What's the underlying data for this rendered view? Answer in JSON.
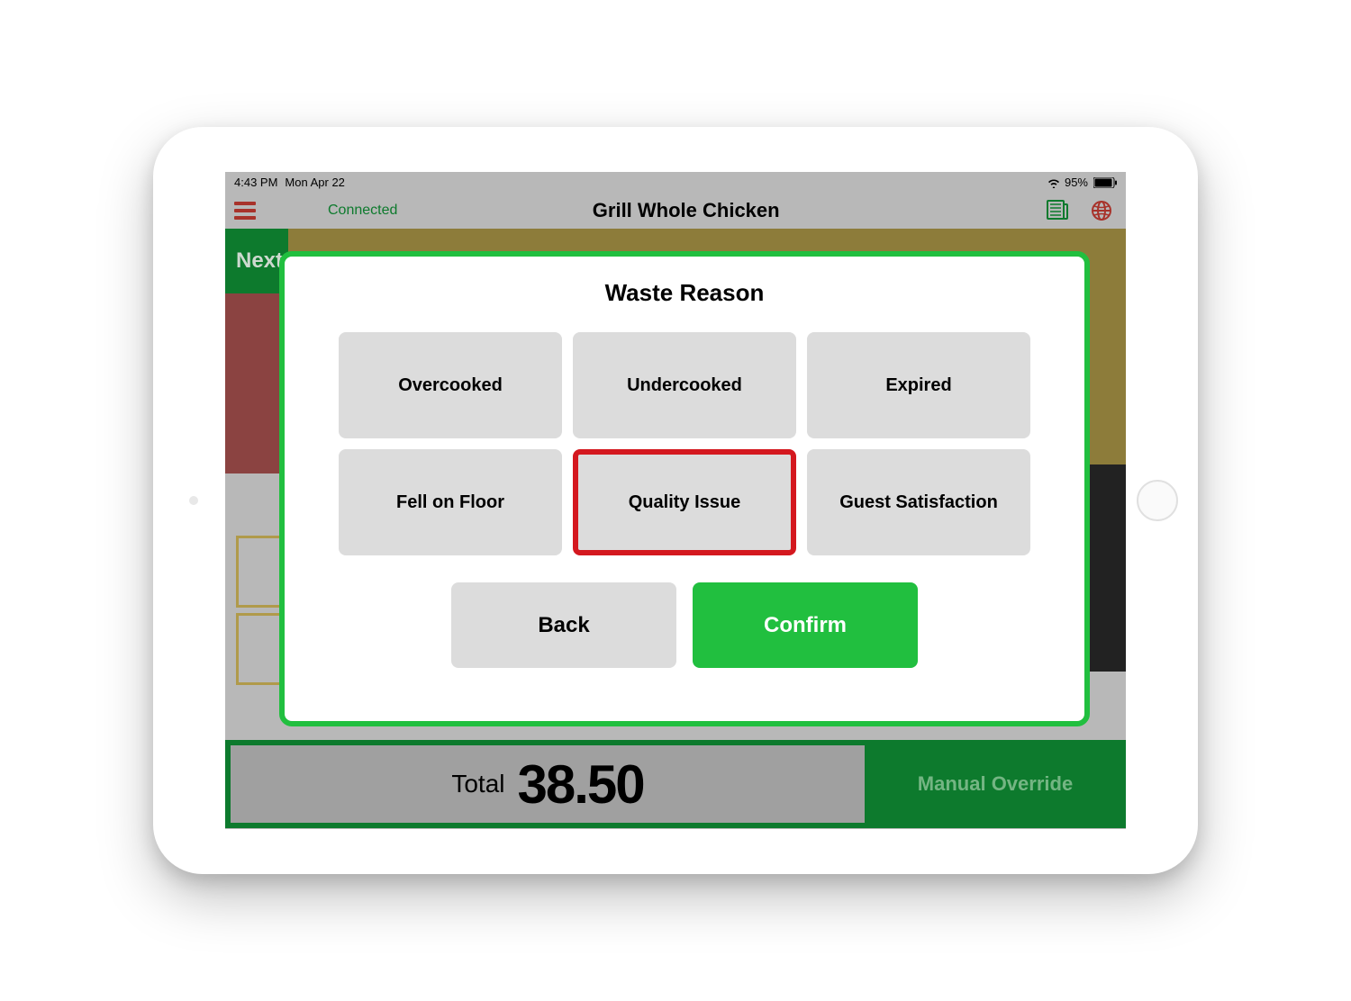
{
  "status_bar": {
    "time": "4:43 PM",
    "date": "Mon Apr 22",
    "battery_pct": "95%"
  },
  "header": {
    "connection_status": "Connected",
    "title": "Grill Whole Chicken"
  },
  "background": {
    "next_label": "Next",
    "total_label": "Total",
    "total_value": "38.50",
    "override_label": "Manual Override"
  },
  "modal": {
    "title": "Waste Reason",
    "reasons": [
      {
        "label": "Overcooked",
        "selected": false
      },
      {
        "label": "Undercooked",
        "selected": false
      },
      {
        "label": "Expired",
        "selected": false
      },
      {
        "label": "Fell on Floor",
        "selected": false
      },
      {
        "label": "Quality Issue",
        "selected": true
      },
      {
        "label": "Guest Satisfaction",
        "selected": false
      }
    ],
    "back_label": "Back",
    "confirm_label": "Confirm"
  }
}
